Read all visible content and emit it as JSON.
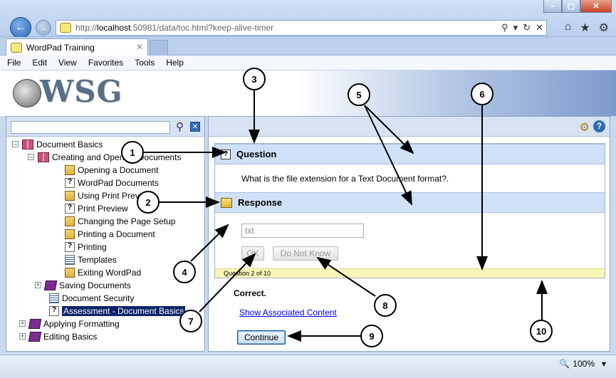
{
  "browser": {
    "url_prefix": "http://",
    "url_host": "localhost",
    "url_rest": ":50981/data/toc.html?keep-alive-timer",
    "addr_tools": [
      "⚲",
      "▾",
      "↻",
      "✕"
    ],
    "browser_icons": [
      "⌂",
      "★",
      "⚙"
    ],
    "tab_title": "WordPad Training",
    "tab_close": "✕",
    "win_buttons": [
      "–",
      "▢",
      "✕"
    ],
    "back_glyph": "←",
    "forward_glyph": "→",
    "zoom": "100%",
    "zoom_icon": "🔍",
    "zoom_caret": "▾",
    "colors": {
      "accent": "#2f6bb4",
      "panel_header": "#d0e0f6",
      "progress_strip": "#fbf5b8",
      "selection": "#0a246a"
    }
  },
  "menu": [
    "File",
    "Edit",
    "View",
    "Favorites",
    "Tools",
    "Help"
  ],
  "banner": {
    "logo_text": "WSG"
  },
  "toc": {
    "search_icon": "⚲",
    "clear_icon": "✕",
    "nodes": [
      {
        "label": "Document Basics",
        "expander": "–",
        "icon": "book-open-icon"
      },
      {
        "label": "Creating and Opening Documents",
        "expander": "–",
        "icon": "book-open-icon"
      },
      {
        "label": "Opening a Document",
        "icon": "multi-page-icon"
      },
      {
        "label": "WordPad Documents",
        "icon": "question-page-icon"
      },
      {
        "label": "Using Print Preview",
        "icon": "multi-page-icon"
      },
      {
        "label": "Print Preview",
        "icon": "question-page-icon"
      },
      {
        "label": "Changing the Page Setup",
        "icon": "multi-page-icon"
      },
      {
        "label": "Printing a Document",
        "icon": "multi-page-icon"
      },
      {
        "label": "Printing",
        "icon": "question-page-icon"
      },
      {
        "label": "Templates",
        "icon": "text-page-icon"
      },
      {
        "label": "Exiting WordPad",
        "icon": "multi-page-icon"
      },
      {
        "label": "Saving Documents",
        "expander": "+",
        "icon": "book-icon"
      },
      {
        "label": "Document Security",
        "icon": "text-page-icon"
      },
      {
        "label": "Assessment - Document Basics",
        "icon": "question-page-icon",
        "selected": true
      },
      {
        "label": "Applying Formatting",
        "expander": "+",
        "icon": "book-icon"
      },
      {
        "label": "Editing Basics",
        "expander": "+",
        "icon": "book-icon"
      }
    ]
  },
  "assessment": {
    "gear_icon": "⚙",
    "help_icon": "?",
    "question_header": "Question",
    "question_icon": "?",
    "question_text": "What is the file extension for a Text Document format?.",
    "response_header": "Response",
    "answer_value": "txt",
    "ok_label": "OK",
    "dont_know_label": "Do Not Know",
    "progress_text": "Question 2 of 10",
    "feedback": "Correct.",
    "show_content_link": "Show Associated Content",
    "continue_label": "Continue"
  },
  "callouts": [
    "1",
    "2",
    "3",
    "4",
    "5",
    "6",
    "7",
    "8",
    "9",
    "10"
  ]
}
